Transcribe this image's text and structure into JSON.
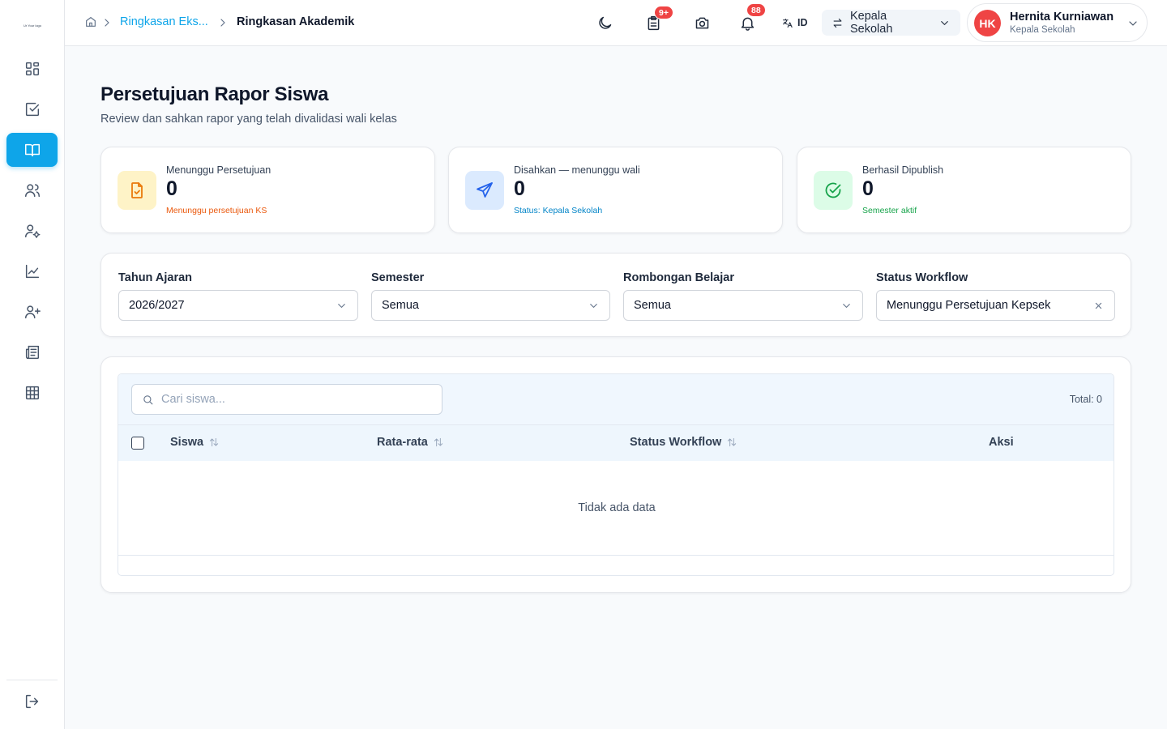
{
  "app": {
    "logo_text": "Ur Your logo"
  },
  "breadcrumb": {
    "parent": "Ringkasan Eks...",
    "current": "Ringkasan Akademik"
  },
  "topbar": {
    "notif_tasks_badge": "9+",
    "notif_bell_badge": "88",
    "language": "ID",
    "role_switch_label": "Kepala Sekolah",
    "user": {
      "initials": "HK",
      "name": "Hernita Kurniawan",
      "role": "Kepala Sekolah"
    }
  },
  "page": {
    "title": "Persetujuan Rapor Siswa",
    "subtitle": "Review dan sahkan rapor yang telah divalidasi wali kelas"
  },
  "stats": [
    {
      "label": "Menunggu Persetujuan",
      "value": "0",
      "note": "Menunggu persetujuan KS",
      "icon": "file-check-icon",
      "color": "#f97316"
    },
    {
      "label": "Disahkan — menunggu wali",
      "value": "0",
      "note": "Status: Kepala Sekolah",
      "icon": "send-icon",
      "color": "#0ea5e9"
    },
    {
      "label": "Berhasil Dipublish",
      "value": "0",
      "note": "Semester aktif",
      "icon": "check-circle-icon",
      "color": "#22c55e"
    }
  ],
  "filters": [
    {
      "label": "Tahun Ajaran",
      "value": "2026/2027",
      "control": "dropdown"
    },
    {
      "label": "Semester",
      "value": "Semua",
      "control": "dropdown"
    },
    {
      "label": "Rombongan Belajar",
      "value": "Semua",
      "control": "dropdown"
    },
    {
      "label": "Status Workflow",
      "value": "Menunggu Persetujuan Kepsek",
      "control": "clearable"
    }
  ],
  "table": {
    "search_placeholder": "Cari siswa...",
    "total": "Total: 0",
    "columns": [
      "Siswa",
      "Rata-rata",
      "Status Workflow",
      "Aksi"
    ],
    "empty_text": "Tidak ada data"
  }
}
